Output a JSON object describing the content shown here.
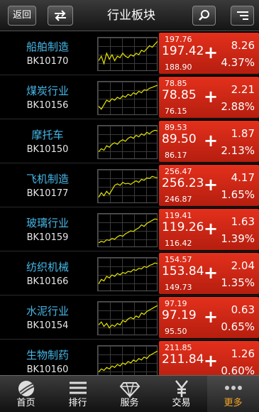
{
  "header": {
    "title": "行业板块",
    "back_label": "返回",
    "icons": [
      "swap-icon",
      "search-icon",
      "menu-icon"
    ]
  },
  "colors": {
    "up_background": "#d42a17",
    "name_text": "#46b8e8",
    "spark_line": "#e6e600",
    "active_tab": "#f5a623"
  },
  "rows": [
    {
      "name": "船舶制造",
      "code": "BK10170",
      "high": "197.76",
      "price": "197.42",
      "low": "188.90",
      "change": "8.26",
      "percent": "4.37%",
      "trend": [
        0.3,
        0.45,
        0.2,
        0.55,
        0.35,
        0.5,
        0.3,
        0.45,
        0.4,
        0.55,
        0.45,
        0.4,
        0.5,
        0.45,
        0.55,
        0.5,
        0.65,
        0.6,
        0.7,
        0.8,
        0.75,
        0.85,
        0.95
      ]
    },
    {
      "name": "煤炭行业",
      "code": "BK10156",
      "high": "78.85",
      "price": "78.85",
      "low": "76.15",
      "change": "2.21",
      "percent": "2.88%",
      "trend": [
        0.25,
        0.15,
        0.3,
        0.45,
        0.4,
        0.5,
        0.45,
        0.55,
        0.5,
        0.6,
        0.55,
        0.65,
        0.6,
        0.7,
        0.65,
        0.75,
        0.7,
        0.8,
        0.78,
        0.85,
        0.88,
        0.92,
        0.95
      ]
    },
    {
      "name": "摩托车",
      "code": "BK10150",
      "high": "89.53",
      "price": "89.50",
      "low": "86.17",
      "change": "1.87",
      "percent": "2.13%",
      "trend": [
        0.2,
        0.3,
        0.25,
        0.4,
        0.35,
        0.45,
        0.5,
        0.45,
        0.55,
        0.6,
        0.55,
        0.65,
        0.7,
        0.65,
        0.75,
        0.7,
        0.8,
        0.75,
        0.85,
        0.8,
        0.88,
        0.92,
        0.9
      ]
    },
    {
      "name": "飞机制造",
      "code": "BK10177",
      "high": "256.47",
      "price": "256.23",
      "low": "246.87",
      "change": "4.17",
      "percent": "1.65%",
      "trend": [
        0.15,
        0.3,
        0.2,
        0.35,
        0.25,
        0.4,
        0.55,
        0.6,
        0.55,
        0.65,
        0.6,
        0.62,
        0.58,
        0.65,
        0.7,
        0.65,
        0.75,
        0.72,
        0.8,
        0.78,
        0.85,
        0.82,
        0.8
      ]
    },
    {
      "name": "玻璃行业",
      "code": "BK10159",
      "high": "119.41",
      "price": "119.26",
      "low": "116.42",
      "change": "1.63",
      "percent": "1.39%",
      "trend": [
        0.1,
        0.15,
        0.12,
        0.2,
        0.18,
        0.25,
        0.22,
        0.3,
        0.35,
        0.32,
        0.4,
        0.45,
        0.5,
        0.48,
        0.55,
        0.6,
        0.7,
        0.65,
        0.75,
        0.8,
        0.85,
        0.9,
        0.88
      ]
    },
    {
      "name": "纺织机械",
      "code": "BK10166",
      "high": "154.57",
      "price": "153.84",
      "low": "149.73",
      "change": "2.04",
      "percent": "1.35%",
      "trend": [
        0.2,
        0.35,
        0.3,
        0.45,
        0.4,
        0.5,
        0.45,
        0.55,
        0.5,
        0.58,
        0.55,
        0.62,
        0.6,
        0.68,
        0.65,
        0.72,
        0.7,
        0.78,
        0.75,
        0.82,
        0.85,
        0.9,
        0.88
      ]
    },
    {
      "name": "水泥行业",
      "code": "BK10154",
      "high": "97.19",
      "price": "97.19",
      "low": "95.50",
      "change": "0.63",
      "percent": "0.65%",
      "trend": [
        0.3,
        0.4,
        0.25,
        0.35,
        0.2,
        0.3,
        0.25,
        0.35,
        0.3,
        0.45,
        0.4,
        0.5,
        0.55,
        0.5,
        0.6,
        0.55,
        0.7,
        0.65,
        0.75,
        0.8,
        0.85,
        0.9,
        0.95
      ]
    },
    {
      "name": "生物制药",
      "code": "BK10160",
      "high": "211.85",
      "price": "211.84",
      "low": "",
      "change": "1.26",
      "percent": "0.60%",
      "trend": [
        0.2,
        0.3,
        0.25,
        0.35,
        0.3,
        0.4,
        0.35,
        0.45,
        0.4,
        0.5,
        0.45,
        0.55,
        0.5,
        0.6,
        0.55,
        0.65,
        0.6,
        0.7,
        0.65,
        0.75,
        0.8,
        0.85,
        0.9
      ]
    }
  ],
  "tabs": [
    {
      "label": "首页",
      "icon": "globe-icon",
      "active": false
    },
    {
      "label": "排行",
      "icon": "list-icon",
      "active": false
    },
    {
      "label": "服务",
      "icon": "diamond-icon",
      "active": false
    },
    {
      "label": "交易",
      "icon": "yen-icon",
      "active": false
    },
    {
      "label": "更多",
      "icon": "more-icon",
      "active": true
    }
  ]
}
